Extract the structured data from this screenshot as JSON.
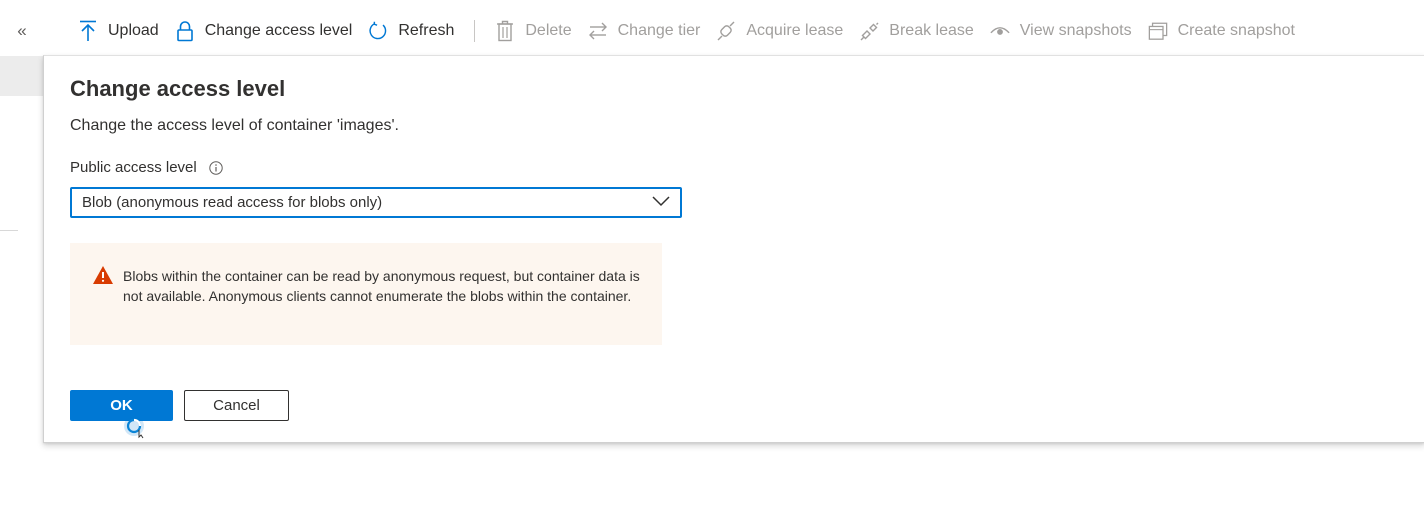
{
  "nav": {
    "collapse_glyph": "«"
  },
  "toolbar": {
    "items": [
      {
        "label": "Upload",
        "icon": "upload-icon",
        "enabled": true
      },
      {
        "label": "Change access level",
        "icon": "lock-icon",
        "enabled": true
      },
      {
        "label": "Refresh",
        "icon": "refresh-icon",
        "enabled": true
      },
      {
        "label": "Delete",
        "icon": "trash-icon",
        "enabled": false
      },
      {
        "label": "Change tier",
        "icon": "swap-arrows-icon",
        "enabled": false
      },
      {
        "label": "Acquire lease",
        "icon": "link-icon",
        "enabled": false
      },
      {
        "label": "Break lease",
        "icon": "broken-link-icon",
        "enabled": false
      },
      {
        "label": "View snapshots",
        "icon": "eye-icon",
        "enabled": false
      },
      {
        "label": "Create snapshot",
        "icon": "snapshot-icon",
        "enabled": false
      }
    ]
  },
  "dialog": {
    "title": "Change access level",
    "description": "Change the access level of container 'images'.",
    "field_label": "Public access level",
    "selected_value": "Blob (anonymous read access for blobs only)",
    "warning_text": "Blobs within the container can be read by anonymous request, but container data is not available. Anonymous clients cannot enumerate the blobs within the container.",
    "ok_label": "OK",
    "cancel_label": "Cancel"
  },
  "colors": {
    "accent": "#0078d4",
    "warning": "#d83b01",
    "warning_bg": "#fdf6ef",
    "disabled_text": "#a19f9d"
  }
}
